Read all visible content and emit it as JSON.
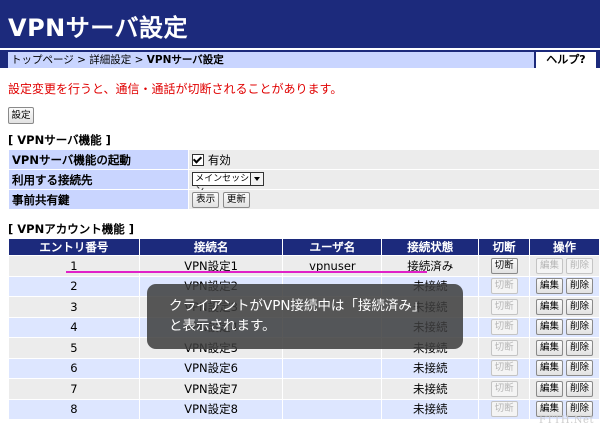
{
  "page": {
    "title": "VPNサーバ設定",
    "breadcrumb": {
      "home": "トップページ",
      "sep1": " > ",
      "detail": "詳細設定",
      "sep2": " > ",
      "current": "VPNサーバ設定"
    },
    "help_label": "ヘルプ?",
    "warning": "設定変更を行うと、通信・通話が切断されることがあります。",
    "settings_button": "設定"
  },
  "function_section": {
    "heading": "[ VPNサーバ機能 ]",
    "rows": {
      "start": {
        "label": "VPNサーバ機能の起動",
        "checkbox_label": "有効",
        "checked": true
      },
      "connection": {
        "label": "利用する接続先",
        "selected": "メインセッション"
      },
      "psk": {
        "label": "事前共有鍵",
        "show_button": "表示",
        "update_button": "更新"
      }
    }
  },
  "account_section": {
    "heading": "[ VPNアカウント機能 ]",
    "columns": [
      "エントリ番号",
      "接続名",
      "ユーザ名",
      "接続状態",
      "切断",
      "操作"
    ],
    "disconnect_label": "切断",
    "edit_label": "編集",
    "delete_label": "削除",
    "rows": [
      {
        "entry": "1",
        "name": "VPN設定1",
        "user": "vpnuser",
        "status": "接続済み"
      },
      {
        "entry": "2",
        "name": "VPN設定2",
        "user": "",
        "status": "未接続"
      },
      {
        "entry": "3",
        "name": "VPN設定3",
        "user": "",
        "status": "未接続"
      },
      {
        "entry": "4",
        "name": "VPN設定4",
        "user": "",
        "status": "未接続"
      },
      {
        "entry": "5",
        "name": "VPN設定5",
        "user": "",
        "status": "未接続"
      },
      {
        "entry": "6",
        "name": "VPN設定6",
        "user": "",
        "status": "未接続"
      },
      {
        "entry": "7",
        "name": "VPN設定7",
        "user": "",
        "status": "未接続"
      },
      {
        "entry": "8",
        "name": "VPN設定8",
        "user": "",
        "status": "未接続"
      }
    ]
  },
  "annotation": {
    "line1": "クライアントがVPN接続中は「接続済み」",
    "line2": "と表示されます。"
  },
  "watermark": "FTTH.Net",
  "colors": {
    "header": "#1c2a7c",
    "label_bg": "#c9d5ff",
    "warning": "#e00000",
    "highlight_line": "#e020c8"
  }
}
